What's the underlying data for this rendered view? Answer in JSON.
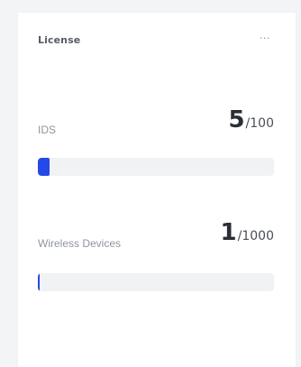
{
  "card": {
    "title": "License",
    "more_icon": "more-horizontal-icon",
    "more_glyph": "···"
  },
  "metrics": [
    {
      "label": "IDS",
      "current": "5",
      "separator": "/",
      "max": "100",
      "progress_fraction": 0.05
    },
    {
      "label": "Wireless Devices",
      "current": "1",
      "separator": "/",
      "max": "1000",
      "progress_fraction": 0.001
    }
  ],
  "colors": {
    "accent": "#2349e6",
    "track": "#f1f2f4",
    "background": "#f3f4f6",
    "card": "#ffffff"
  }
}
